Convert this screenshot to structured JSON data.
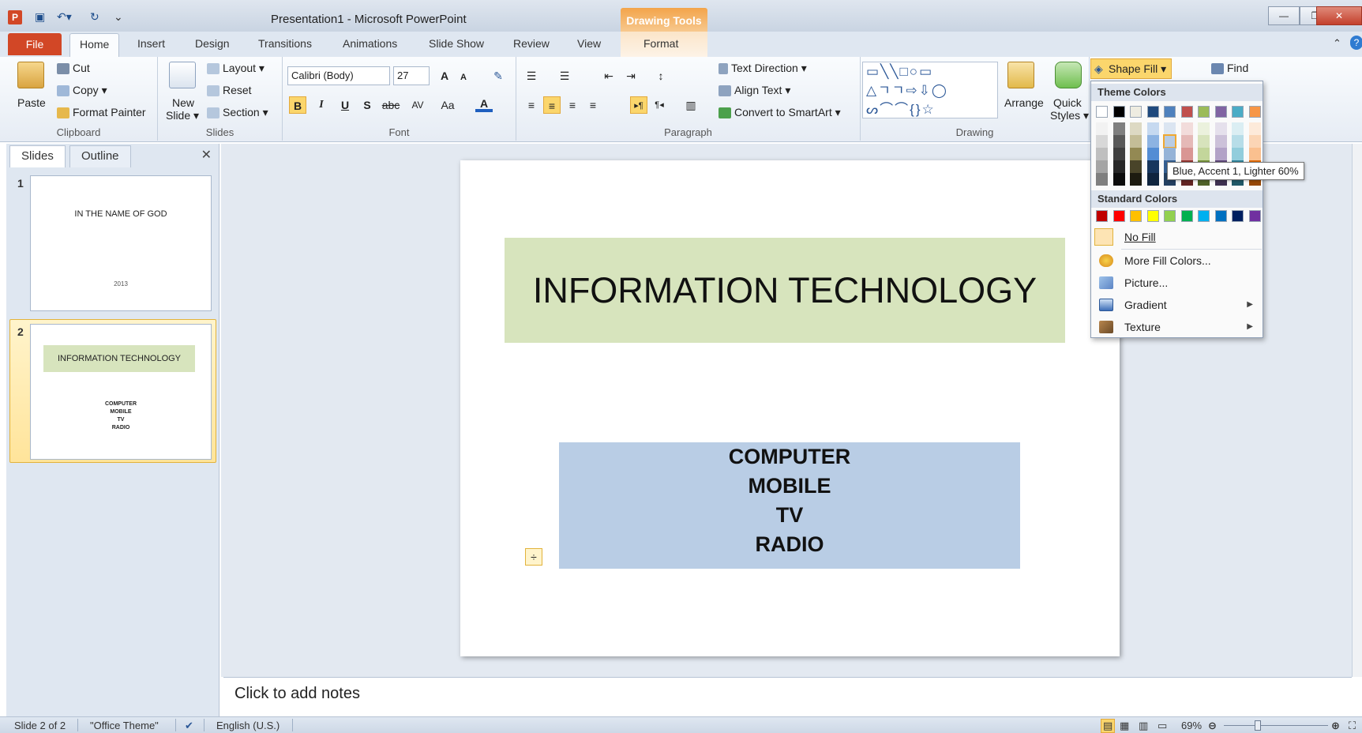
{
  "window": {
    "title": "Presentation1  -  Microsoft PowerPoint",
    "app_icon_letter": "P",
    "contextual_tab": "Drawing Tools",
    "controls": {
      "minimize": "—",
      "restore": "❐",
      "close": "✕"
    }
  },
  "tabs": {
    "file": "File",
    "home": "Home",
    "insert": "Insert",
    "design": "Design",
    "transitions": "Transitions",
    "animations": "Animations",
    "slideshow": "Slide Show",
    "review": "Review",
    "view": "View",
    "format": "Format"
  },
  "ribbon": {
    "clipboard": {
      "label": "Clipboard",
      "paste": "Paste",
      "cut": "Cut",
      "copy": "Copy ▾",
      "format_painter": "Format Painter"
    },
    "slides": {
      "label": "Slides",
      "new_slide_1": "New",
      "new_slide_2": "Slide ▾",
      "layout": "Layout ▾",
      "reset": "Reset",
      "section": "Section ▾"
    },
    "font": {
      "label": "Font",
      "family": "Calibri (Body)",
      "size": "27",
      "grow": "A",
      "shrink": "A",
      "bold": "B",
      "italic": "I",
      "underline": "U",
      "shadow": "S",
      "strike": "abc",
      "spacing": "AV",
      "case": "Aa",
      "color": "A"
    },
    "paragraph": {
      "label": "Paragraph",
      "text_direction": "Text Direction ▾",
      "align_text": "Align Text ▾",
      "smartart": "Convert to SmartArt ▾"
    },
    "drawing": {
      "label": "Drawing",
      "arrange": "Arrange",
      "quick_styles_1": "Quick",
      "quick_styles_2": "Styles ▾",
      "shape_fill": "Shape Fill ▾",
      "shapes_row1": "▭╲╲□○▭",
      "shapes_row2": "△ㄱㄱ⇨⇩◯",
      "shapes_row3": "ᔕ⌒⌒{}☆"
    },
    "editing": {
      "find": "Find"
    }
  },
  "pane": {
    "tab_slides": "Slides",
    "tab_outline": "Outline",
    "close": "✕",
    "thumbs": [
      {
        "num": "1",
        "title": "IN THE NAME OF GOD",
        "sub": "2013"
      },
      {
        "num": "2",
        "title": "INFORMATION TECHNOLOGY",
        "lines": [
          "COMPUTER",
          "MOBILE",
          "TV",
          "RADIO"
        ]
      }
    ]
  },
  "slide": {
    "title": "INFORMATION TECHNOLOGY",
    "body": [
      "COMPUTER",
      "MOBILE",
      "TV",
      "RADIO"
    ]
  },
  "notes": {
    "placeholder": "Click to add notes"
  },
  "status": {
    "slide": "Slide 2 of 2",
    "theme": "\"Office Theme\"",
    "language": "English (U.S.)",
    "zoom": "69%",
    "zoom_level_percent": 69
  },
  "fill_menu": {
    "theme_colors_label": "Theme Colors",
    "standard_colors_label": "Standard Colors",
    "no_fill": "No Fill",
    "more_colors": "More Fill Colors...",
    "picture": "Picture...",
    "gradient": "Gradient",
    "texture": "Texture",
    "tooltip": "Blue, Accent 1, Lighter 60%",
    "theme_colors": [
      "#ffffff",
      "#000000",
      "#eeece1",
      "#1f497d",
      "#4f81bd",
      "#c0504d",
      "#9bbb59",
      "#8064a2",
      "#4bacc6",
      "#f79646"
    ],
    "theme_shades": [
      [
        "#f2f2f2",
        "#d8d8d8",
        "#bfbfbf",
        "#a5a5a5",
        "#7f7f7f"
      ],
      [
        "#7f7f7f",
        "#595959",
        "#3f3f3f",
        "#262626",
        "#0c0c0c"
      ],
      [
        "#ddd9c3",
        "#c4bd97",
        "#938953",
        "#494429",
        "#1d1b10"
      ],
      [
        "#c6d9f0",
        "#8db3e2",
        "#548dd4",
        "#17365d",
        "#0f243e"
      ],
      [
        "#dbe5f1",
        "#b8cce4",
        "#95b3d7",
        "#366092",
        "#244061"
      ],
      [
        "#f2dcdb",
        "#e5b9b7",
        "#d99694",
        "#953734",
        "#632423"
      ],
      [
        "#ebf1dd",
        "#d7e3bc",
        "#c3d69b",
        "#76923c",
        "#4f6128"
      ],
      [
        "#e5e0ec",
        "#ccc1d9",
        "#b2a2c7",
        "#5f497a",
        "#3f3151"
      ],
      [
        "#dbeef3",
        "#b7dde8",
        "#92cddc",
        "#31859b",
        "#205867"
      ],
      [
        "#fdeada",
        "#fbd5b5",
        "#fac08f",
        "#e36c09",
        "#974806"
      ]
    ],
    "standard_colors": [
      "#c00000",
      "#ff0000",
      "#ffc000",
      "#ffff00",
      "#92d050",
      "#00b050",
      "#00b0f0",
      "#0070c0",
      "#002060",
      "#7030a0"
    ]
  }
}
